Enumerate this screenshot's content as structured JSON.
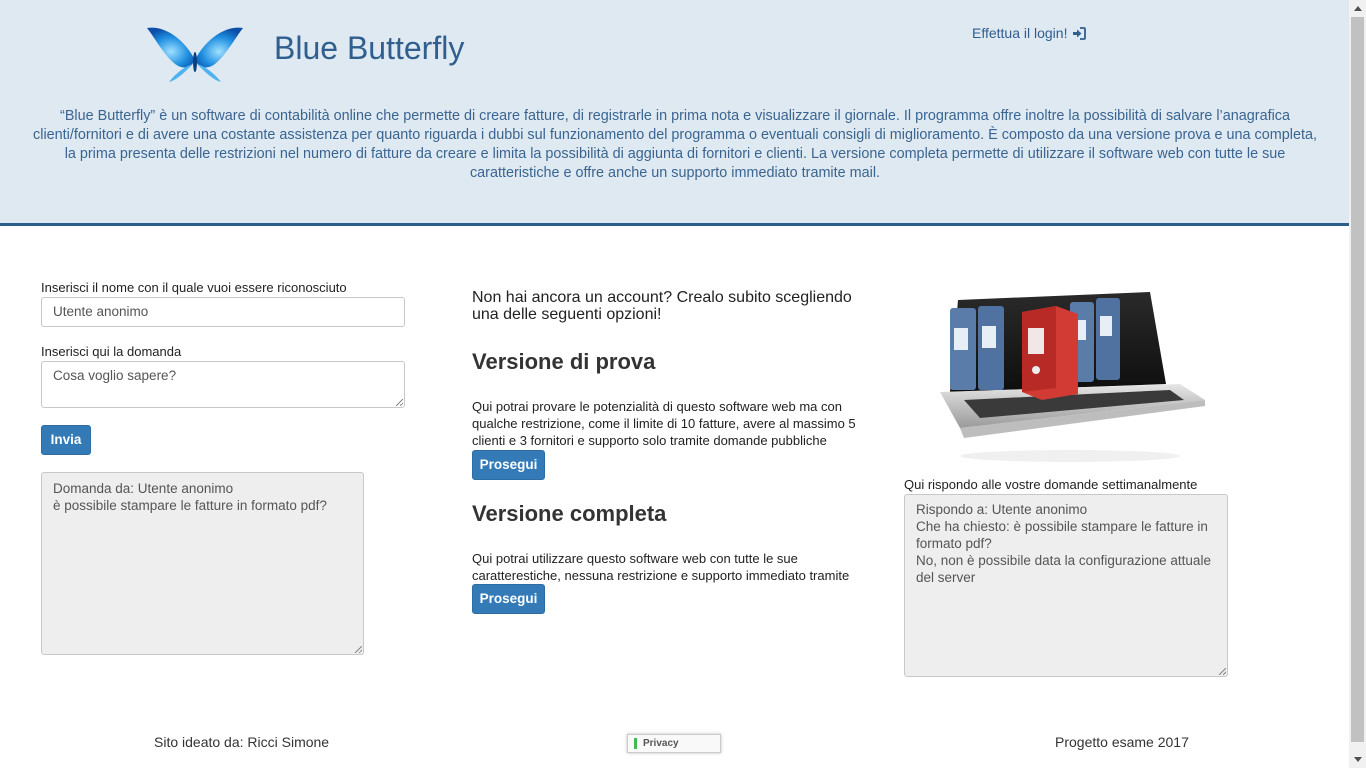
{
  "header": {
    "brand": "Blue Butterfly",
    "login_label": "Effettua il login!",
    "intro": "“Blue Butterfly” è un software di contabilità online che permette di creare fatture, di registrarle in prima nota e visualizzare il giornale. Il programma offre inoltre la possibilità di salvare l’anagrafica clienti/fornitori e di avere una costante assistenza per quanto riguarda i dubbi sul funzionamento del programma o eventuali consigli di miglioramento. È composto da una versione prova e una completa, la prima presenta delle restrizioni nel numero di fatture da creare e limita la possibilità di aggiunta di fornitori e clienti. La versione completa permette di utilizzare il software web con tutte le sue caratteristiche e offre anche un supporto immediato tramite mail."
  },
  "question_form": {
    "name_label": "Inserisci il nome con il quale vuoi essere riconosciuto",
    "name_value": "Utente anonimo",
    "question_label": "Inserisci qui la domanda",
    "question_value": "Cosa voglio sapere?",
    "submit_label": "Invia",
    "history": "Domanda da: Utente anonimo\nè possibile stampare le fatture in formato pdf?"
  },
  "signup": {
    "intro": "Non hai ancora un account? Crealo subito scegliendo una delle seguenti opzioni!",
    "trial_title": "Versione di prova",
    "trial_text": "Qui potrai provare le potenzialità di questo software web ma con qualche restrizione, come il limite di 10 fatture, avere al massimo 5 clienti e 3 fornitori e supporto solo tramite domande pubbliche",
    "trial_button": "Prosegui",
    "full_title": "Versione completa",
    "full_text": "Qui potrai utilizzare questo software web con tutte le sue caratterestiche, nessuna restrizione e supporto immediato tramite mail",
    "full_button": "Prosegui"
  },
  "answers": {
    "label": "Qui rispondo alle vostre domande settimanalmente",
    "text": "Rispondo a: Utente anonimo\nChe ha chiesto: è possibile stampare le fatture in formato pdf?\nNo, non è possibile data la configurazione attuale del server"
  },
  "footer": {
    "author": "Sito ideato da: Ricci Simone",
    "privacy": "Privacy",
    "project": "Progetto esame 2017"
  },
  "colors": {
    "header_bg": "#dfe9f1",
    "accent": "#337ab7",
    "brand_text": "#2f5e8f"
  }
}
